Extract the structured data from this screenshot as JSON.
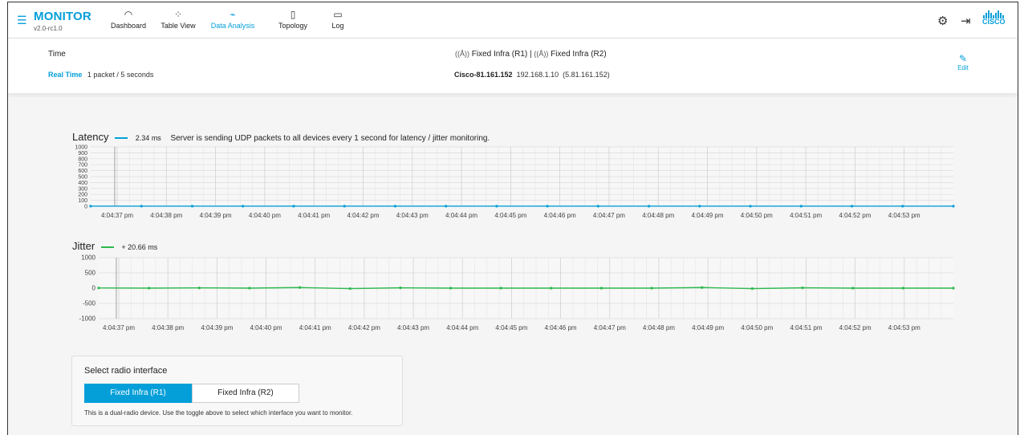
{
  "app": {
    "title": "MONITOR",
    "version": "v2.0-rc1.0"
  },
  "nav": [
    {
      "label": "Dashboard",
      "icon": "gauge-icon",
      "glyph": "◠",
      "active": false
    },
    {
      "label": "Table View",
      "icon": "network-nodes-icon",
      "glyph": "⁘",
      "active": false
    },
    {
      "label": "Data Analysis",
      "icon": "chart-line-icon",
      "glyph": "⌁",
      "active": true
    },
    {
      "label": "Topology",
      "icon": "map-book-icon",
      "glyph": "▯",
      "active": false
    },
    {
      "label": "Log",
      "icon": "log-file-icon",
      "glyph": "▭",
      "active": false
    }
  ],
  "topright": {
    "settings_icon": "gear-icon",
    "logout_icon": "exit-door-icon",
    "logo_text": "CISCO"
  },
  "info": {
    "time_label": "Time",
    "realtime_label": "Real Time",
    "rate_text": "1 packet / 5 seconds",
    "iface_r1": "Fixed Infra (R1)",
    "iface_sep": "|",
    "iface_r2": "Fixed Infra (R2)",
    "device_name": "Cisco-81.161.152",
    "device_ip": "192.168.1.10",
    "device_ip_alt": "(5.81.161.152)",
    "edit_label": "Edit"
  },
  "latency": {
    "label": "Latency",
    "value_text": "2.34 ms",
    "description": "Server is sending UDP packets to all devices every 1 second for latency / jitter monitoring.",
    "color": "#049fd9"
  },
  "jitter": {
    "label": "Jitter",
    "value_text": "+ 20.66 ms",
    "color": "#2db84d"
  },
  "chart_data": [
    {
      "type": "line",
      "title": "Latency",
      "x": [
        "4:04:37 pm",
        "4:04:38 pm",
        "4:04:39 pm",
        "4:04:40 pm",
        "4:04:41 pm",
        "4:04:42 pm",
        "4:04:43 pm",
        "4:04:44 pm",
        "4:04:45 pm",
        "4:04:46 pm",
        "4:04:47 pm",
        "4:04:48 pm",
        "4:04:49 pm",
        "4:04:50 pm",
        "4:04:51 pm",
        "4:04:52 pm",
        "4:04:53 pm"
      ],
      "yticks": [
        0,
        100,
        200,
        300,
        400,
        500,
        600,
        700,
        800,
        900,
        1000
      ],
      "ylim": [
        0,
        1000
      ],
      "series": [
        {
          "name": "Latency",
          "color": "#049fd9",
          "values": [
            2,
            2,
            2,
            2,
            2,
            2,
            2,
            2,
            2,
            2,
            2,
            2,
            2,
            2,
            2,
            2,
            2,
            2
          ]
        }
      ],
      "grid": true
    },
    {
      "type": "line",
      "title": "Jitter",
      "x": [
        "4:04:37 pm",
        "4:04:38 pm",
        "4:04:39 pm",
        "4:04:40 pm",
        "4:04:41 pm",
        "4:04:42 pm",
        "4:04:43 pm",
        "4:04:44 pm",
        "4:04:45 pm",
        "4:04:46 pm",
        "4:04:47 pm",
        "4:04:48 pm",
        "4:04:49 pm",
        "4:04:50 pm",
        "4:04:51 pm",
        "4:04:52 pm",
        "4:04:53 pm"
      ],
      "yticks": [
        -1000,
        -500,
        0,
        500,
        1000
      ],
      "ylim": [
        -1000,
        1000
      ],
      "series": [
        {
          "name": "Jitter",
          "color": "#2db84d",
          "values": [
            5,
            0,
            8,
            0,
            20,
            -15,
            10,
            0,
            0,
            0,
            0,
            0,
            20,
            -15,
            10,
            0,
            0,
            0
          ]
        }
      ],
      "grid": true
    }
  ],
  "radio": {
    "title": "Select radio interface",
    "option_r1": "Fixed Infra (R1)",
    "option_r2": "Fixed Infra (R2)",
    "hint": "This is a dual-radio device. Use the toggle above to select which interface you want to monitor."
  }
}
